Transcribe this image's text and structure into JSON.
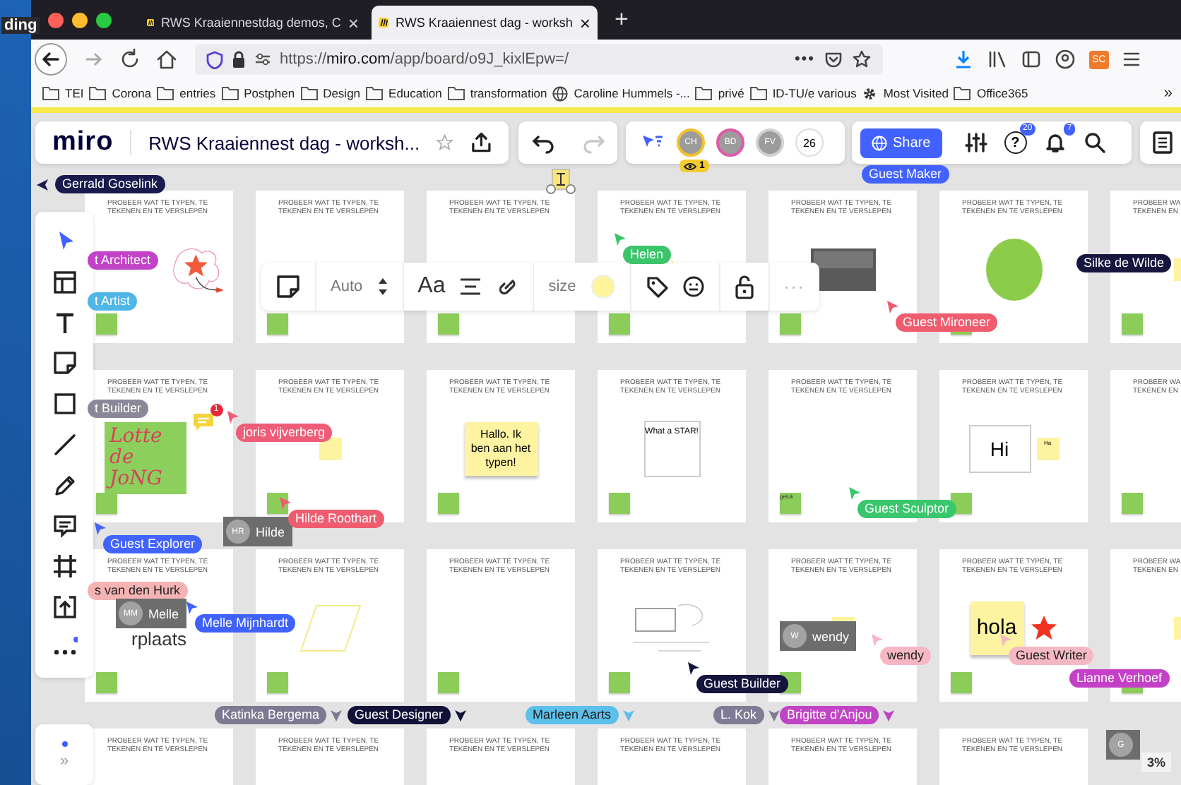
{
  "desktop": {
    "label": "ding"
  },
  "browser": {
    "tabs": [
      {
        "title": "RWS Kraaiennestdag demos, C",
        "close": "×",
        "selected": false
      },
      {
        "title": "RWS Kraaiennest dag - worksh",
        "close": "×",
        "selected": true
      }
    ],
    "new_tab": "+",
    "url": "https://**miro.com**/app/board/o9J_kixlEpw=/",
    "page_actions": "•••",
    "profile_badge": "SC",
    "bookmarks": [
      {
        "label": "TEI",
        "kind": "folder"
      },
      {
        "label": "Corona",
        "kind": "folder"
      },
      {
        "label": "entries",
        "kind": "folder"
      },
      {
        "label": "Postphen",
        "kind": "folder"
      },
      {
        "label": "Design",
        "kind": "folder"
      },
      {
        "label": "Education",
        "kind": "folder"
      },
      {
        "label": "transformation",
        "kind": "folder"
      },
      {
        "label": "Caroline Hummels -...",
        "kind": "site"
      },
      {
        "label": "privé",
        "kind": "folder"
      },
      {
        "label": "ID-TU/e various",
        "kind": "folder"
      },
      {
        "label": "Most Visited",
        "kind": "gear"
      },
      {
        "label": "Office365",
        "kind": "folder"
      }
    ],
    "bookmarks_overflow": "»"
  },
  "miro": {
    "logo": "miro",
    "board_title": "RWS Kraaiennest dag - worksh...",
    "undo": {
      "disabled": false
    },
    "redo": {
      "disabled": true
    },
    "collaborators": [
      {
        "initials": "CH",
        "color": "#f2c12e"
      },
      {
        "initials": "BD",
        "color": "#e05aa8"
      },
      {
        "initials": "FV",
        "color": "#d0d0d0"
      }
    ],
    "collaborator_count": "26",
    "viewer_count": "1",
    "share": "Share",
    "help": "?",
    "help_badge": "20",
    "notification_badge": "7",
    "zoom_level": "3%",
    "panel_toggle": "»"
  },
  "tools": [
    {
      "kind": "select",
      "selected": true
    },
    {
      "kind": "templates",
      "selected": false
    },
    {
      "kind": "text",
      "selected": false
    },
    {
      "kind": "sticky",
      "selected": false
    },
    {
      "kind": "shape",
      "selected": false
    },
    {
      "kind": "line",
      "selected": false
    },
    {
      "kind": "pen",
      "selected": false
    },
    {
      "kind": "comment",
      "selected": false
    },
    {
      "kind": "frame",
      "selected": false
    },
    {
      "kind": "upload",
      "selected": false
    },
    {
      "kind": "more",
      "selected": false
    }
  ],
  "context_toolbar": {
    "font_size": "Auto",
    "font": "Aa",
    "size": "size",
    "more": "···"
  },
  "cards": [
    {
      "heading": "PROBEER WAT TE TYPEN, TE\nTEKENEN EN TE VERSLEPEN",
      "items": [
        {
          "kind": "scribble-star"
        },
        {
          "kind": "tab"
        }
      ]
    },
    {
      "heading": "PROBEER WAT TE TYPEN, TE\nTEKENEN EN TE VERSLEPEN",
      "items": [
        {
          "kind": "bar"
        },
        {
          "kind": "tab"
        }
      ]
    },
    {
      "heading": "PROBEER WAT TE TYPEN, TE\nTEKENEN EN TE VERSLEPEN",
      "items": [
        {
          "kind": "tab"
        }
      ]
    },
    {
      "heading": "PROBEER WAT TE TYPEN, TE\nTEKENEN EN TE VERSLEPEN",
      "items": [
        {
          "kind": "small-star"
        },
        {
          "kind": "tab"
        }
      ]
    },
    {
      "heading": "PROBEER WAT TE TYPEN, TE\nTEKENEN EN TE VERSLEPEN",
      "items": [
        {
          "kind": "dark-block"
        },
        {
          "kind": "tab"
        }
      ]
    },
    {
      "heading": "PROBEER WAT TE TYPEN, TE\nTEKENEN EN TE VERSLEPEN",
      "items": [
        {
          "kind": "circle"
        },
        {
          "kind": "tab"
        }
      ]
    },
    {
      "heading": "PROBEER WA\nTEKENEN EN",
      "items": [
        {
          "kind": "sticky-small"
        },
        {
          "kind": "tab"
        }
      ]
    },
    {
      "heading": "PROBEER WAT TE TYPEN, TE\nTEKENEN EN TE VERSLEPEN",
      "items": [
        {
          "kind": "handwriting",
          "text": "Lotte de JoNG"
        },
        {
          "kind": "comment",
          "count": "1"
        },
        {
          "kind": "tab"
        }
      ]
    },
    {
      "heading": "PROBEER WAT TE TYPEN, TE\nTEKENEN EN TE VERSLEPEN",
      "items": [
        {
          "kind": "sticky-small"
        },
        {
          "kind": "tab"
        }
      ]
    },
    {
      "heading": "PROBEER WAT TE TYPEN, TE\nTEKENEN EN TE VERSLEPEN",
      "items": [
        {
          "kind": "sticky",
          "text": "Hallo. Ik ben aan het typen!"
        },
        {
          "kind": "tab"
        }
      ]
    },
    {
      "heading": "PROBEER WAT TE TYPEN, TE\nTEKENEN EN TE VERSLEPEN",
      "items": [
        {
          "kind": "note",
          "text": "What a STAR!"
        },
        {
          "kind": "tab"
        }
      ]
    },
    {
      "heading": "PROBEER WAT TE TYPEN, TE\nTEKENEN EN TE VERSLEPEN",
      "items": [
        {
          "kind": "tab",
          "text": "geluk"
        }
      ]
    },
    {
      "heading": "PROBEER WAT TE TYPEN, TE\nTEKENEN EN TE VERSLEPEN",
      "items": [
        {
          "kind": "big-note",
          "text": "Hi"
        },
        {
          "kind": "sticky-small",
          "text": "Ha"
        },
        {
          "kind": "tab"
        }
      ]
    },
    {
      "heading": "PROBEER WA\nTEKENEN EN",
      "items": [
        {
          "kind": "tab"
        }
      ]
    },
    {
      "heading": "PROBEER WAT TE TYPEN, TE\nTEKENEN EN TE VERSLEPEN",
      "items": [
        {
          "kind": "big-text",
          "text": "rplaats"
        },
        {
          "kind": "tab"
        }
      ]
    },
    {
      "heading": "PROBEER WAT TE TYPEN, TE\nTEKENEN EN TE VERSLEPEN",
      "items": [
        {
          "kind": "parallelogram"
        },
        {
          "kind": "tab"
        }
      ]
    },
    {
      "heading": "PROBEER WAT TE TYPEN, TE\nTEKENEN EN TE VERSLEPEN",
      "items": [
        {
          "kind": "tab"
        }
      ]
    },
    {
      "heading": "PROBEER WAT TE TYPEN, TE\nTEKENEN EN TE VERSLEPEN",
      "items": [
        {
          "kind": "sketch"
        },
        {
          "kind": "tab"
        }
      ]
    },
    {
      "heading": "PROBEER WAT TE TYPEN, TE\nTEKENEN EN TE VERSLEPEN",
      "items": [
        {
          "kind": "sticky-small"
        },
        {
          "kind": "tab"
        }
      ]
    },
    {
      "heading": "PROBEER WAT TE TYPEN, TE\nTEKENEN EN TE VERSLEPEN",
      "items": [
        {
          "kind": "big-sticky",
          "text": "hola"
        },
        {
          "kind": "star"
        },
        {
          "kind": "tab"
        }
      ]
    },
    {
      "heading": "PROBEER WA\nTEKENEN EN",
      "items": [
        {
          "kind": "sticky-small"
        },
        {
          "kind": "tab"
        }
      ]
    },
    {
      "heading": "PROBEER WAT TE TYPEN, TE\nTEKENEN EN TE VERSLEPEN"
    },
    {
      "heading": "PROBEER WAT TE TYPEN, TE\nTEKENEN EN TE VERSLEPEN"
    },
    {
      "heading": "PROBEER WAT TE TYPEN, TE\nTEKENEN EN TE VERSLEPEN"
    },
    {
      "heading": "PROBEER WAT TE TYPEN, TE\nTEKENEN EN TE VERSLEPEN"
    },
    {
      "heading": "PROBEER WAT TE TYPEN, TE\nTEKENEN EN TE VERSLEPEN"
    },
    {
      "heading": "PROBEER WAT TE TYPEN, TE\nTEKENEN EN TE VERSLEPEN"
    }
  ],
  "cursors": [
    {
      "kind": "edge",
      "name": "Gerrald Goselink",
      "color": "#1a1a4e"
    },
    {
      "kind": "tag",
      "name": "Guest Maker",
      "color": "#4262ff"
    },
    {
      "kind": "tag",
      "name": "t Architect",
      "color": "#c242c8"
    },
    {
      "kind": "tag",
      "name": "t Artist",
      "color": "#4fb6e6"
    },
    {
      "kind": "pointer",
      "name": "Helen",
      "color": "#3cc46a"
    },
    {
      "kind": "tag",
      "name": "Silke de Wilde",
      "color": "#16163e"
    },
    {
      "kind": "pointer",
      "name": "Guest Mironeer",
      "color": "#ef5c6e"
    },
    {
      "kind": "tag",
      "name": "t Builder",
      "color": "#8a8898"
    },
    {
      "kind": "pointer",
      "name": "joris vijverberg",
      "color": "#ef5c78"
    },
    {
      "kind": "avatar",
      "initials": "HR",
      "name": "Hilde"
    },
    {
      "kind": "pointer",
      "name": "Hilde Roothart",
      "color": "#ef5c70"
    },
    {
      "kind": "pointer",
      "name": "Guest Explorer",
      "color": "#4263fe"
    },
    {
      "kind": "tag",
      "name": "s van den Hurk",
      "color": "#f6b3b3"
    },
    {
      "kind": "avatar",
      "initials": "MM",
      "name": "Melle"
    },
    {
      "kind": "pointer",
      "name": "Melle Mijnhardt",
      "color": "#4061fc"
    },
    {
      "kind": "pointer",
      "name": "Guest Sculptor",
      "color": "#3ac66c"
    },
    {
      "kind": "avatar",
      "initials": "W",
      "name": "wendy"
    },
    {
      "kind": "pointer",
      "name": "wendy",
      "color": "#f7b6c4"
    },
    {
      "kind": "pointer",
      "name": "Guest Writer",
      "color": "#f5b8c2"
    },
    {
      "kind": "tag",
      "name": "Lianne Verhoef",
      "color": "#c440c6"
    },
    {
      "kind": "pointer",
      "name": "Guest Builder",
      "color": "#14143c"
    },
    {
      "kind": "pointer-down",
      "name": "Katinka Bergema",
      "color": "#7c7a92"
    },
    {
      "kind": "pointer-down",
      "name": "Guest Designer",
      "color": "#121238"
    },
    {
      "kind": "pointer-down",
      "name": "Marleen Aarts",
      "color": "#5cc0ea"
    },
    {
      "kind": "pointer-down",
      "name": "L. Kok",
      "color": "#7e7c94"
    },
    {
      "kind": "pointer-down",
      "name": "Brigitte d'Anjou",
      "color": "#c044c4"
    },
    {
      "kind": "avatar",
      "initials": "G"
    }
  ]
}
